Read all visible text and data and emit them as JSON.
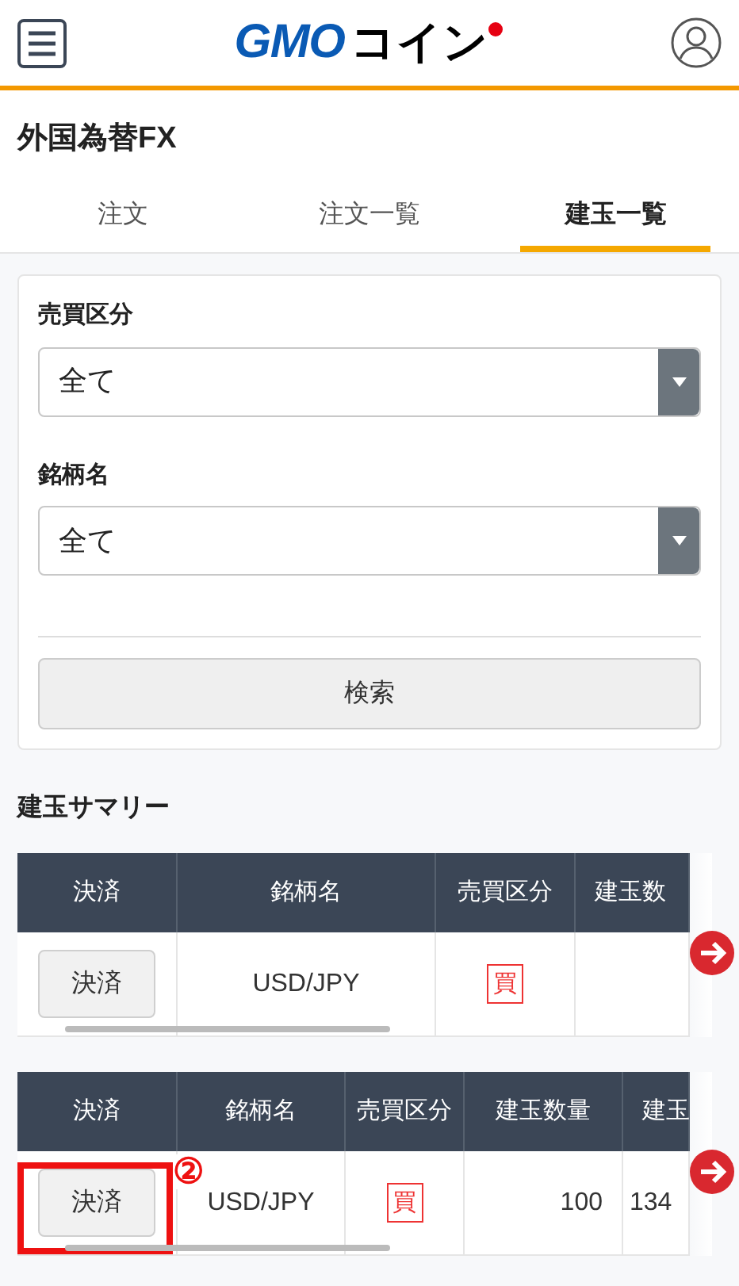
{
  "header": {
    "logo_primary": "GMO",
    "logo_secondary": "コイン"
  },
  "page_title": "外国為替FX",
  "tabs": [
    {
      "label": "注文",
      "selected": false
    },
    {
      "label": "注文一覧",
      "selected": false
    },
    {
      "label": "建玉一覧",
      "selected": true
    }
  ],
  "filters": [
    {
      "label": "売買区分",
      "value": "全て"
    },
    {
      "label": "銘柄名",
      "value": "全て"
    }
  ],
  "search_button": "検索",
  "summary_title": "建玉サマリー",
  "tables": [
    {
      "columns": [
        "決済",
        "銘柄名",
        "売買区分",
        "建玉数"
      ],
      "rows": [
        {
          "highlighted": false,
          "cells": [
            {
              "kind": "button",
              "text": "決済"
            },
            {
              "kind": "text",
              "text": "USD/JPY"
            },
            {
              "kind": "badge",
              "text": "買"
            }
          ]
        }
      ]
    },
    {
      "columns": [
        "決済",
        "銘柄名",
        "売買区分",
        "建玉数量",
        "建玉"
      ],
      "rows": [
        {
          "highlighted": true,
          "cells": [
            {
              "kind": "button",
              "text": "決済"
            },
            {
              "kind": "text",
              "text": "USD/JPY"
            },
            {
              "kind": "badge",
              "text": "買"
            },
            {
              "kind": "number",
              "text": "100"
            },
            {
              "kind": "cut",
              "text": "134"
            }
          ]
        }
      ]
    }
  ],
  "callout": {
    "label": "②"
  }
}
